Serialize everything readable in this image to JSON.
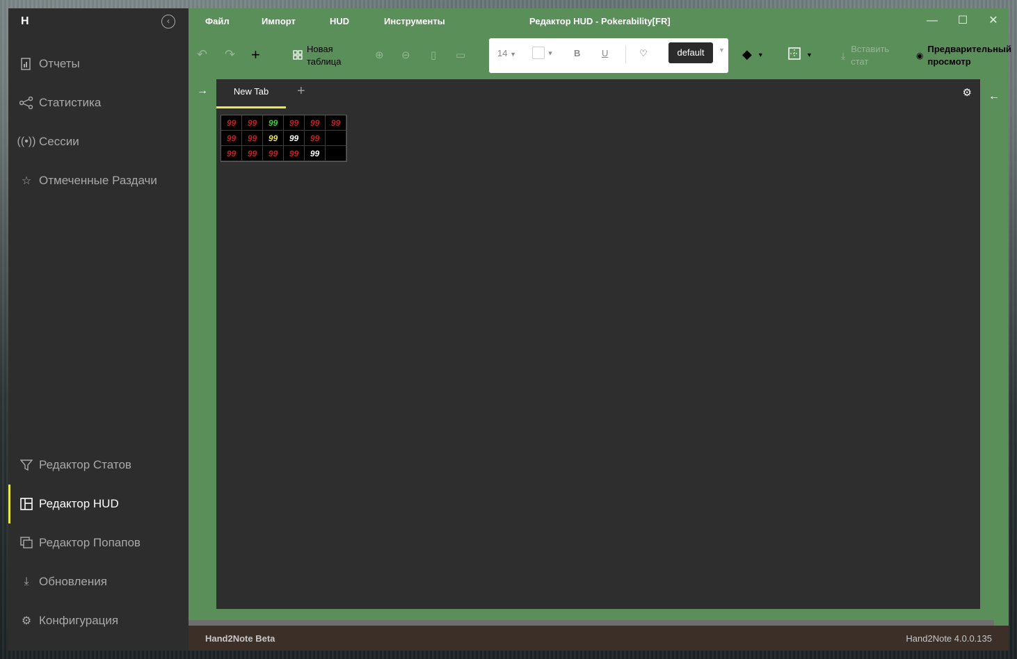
{
  "app": {
    "window_title": "Редактор HUD - Pokerability[FR]",
    "logo": "H"
  },
  "colors": {
    "accent": "#e8e84a",
    "main_bg": "#5a8f5a",
    "sidebar_bg": "#2d2d2d",
    "editor_bg": "#2e2e2e",
    "status_bg": "#3b2f27",
    "stat_red": "#d11d1d",
    "stat_green": "#2fd82f",
    "stat_yellow": "#e8e84a",
    "stat_white": "#ffffff"
  },
  "sidebar": {
    "items_top": [
      {
        "label": "Отчеты",
        "icon": "report-icon"
      },
      {
        "label": "Статистика",
        "icon": "share-graph-icon"
      },
      {
        "label": "Сессии",
        "icon": "broadcast-icon"
      },
      {
        "label": "Отмеченные Раздачи",
        "icon": "star-list-icon"
      }
    ],
    "items_bottom": [
      {
        "label": "Редактор Статов",
        "icon": "filter-icon"
      },
      {
        "label": "Редактор HUD",
        "icon": "layout-icon",
        "active": true
      },
      {
        "label": "Редактор Попапов",
        "icon": "windows-icon"
      },
      {
        "label": "Обновления",
        "icon": "download-icon"
      },
      {
        "label": "Конфигурация",
        "icon": "gear-icon"
      }
    ]
  },
  "menubar": {
    "items": [
      "Файл",
      "Импорт",
      "HUD",
      "Инструменты"
    ]
  },
  "toolbar": {
    "new_table_line1": "Новая",
    "new_table_line2": "таблица",
    "font_size": "14",
    "bold": "B",
    "underline": "U",
    "style_value": "default",
    "insert_stat_line1": "Вставить",
    "insert_stat_line2": "стат",
    "preview_line1": "Предварительный",
    "preview_line2": "просмотр"
  },
  "editor": {
    "tab_label": "New Tab",
    "hud_rows": [
      [
        {
          "v": "99",
          "c": "red"
        },
        {
          "v": "99",
          "c": "red"
        },
        {
          "v": "99",
          "c": "green"
        },
        {
          "v": "99",
          "c": "red"
        },
        {
          "v": "99",
          "c": "red"
        },
        {
          "v": "99",
          "c": "red"
        }
      ],
      [
        {
          "v": "99",
          "c": "red"
        },
        {
          "v": "99",
          "c": "red"
        },
        {
          "v": "99",
          "c": "yellow"
        },
        {
          "v": "99",
          "c": "white"
        },
        {
          "v": "99",
          "c": "red"
        },
        {
          "v": "",
          "c": "red"
        }
      ],
      [
        {
          "v": "99",
          "c": "red"
        },
        {
          "v": "99",
          "c": "red"
        },
        {
          "v": "99",
          "c": "red"
        },
        {
          "v": "99",
          "c": "red"
        },
        {
          "v": "99",
          "c": "white"
        },
        {
          "v": "",
          "c": "red"
        }
      ]
    ]
  },
  "status": {
    "left": "Hand2Note Beta",
    "right": "Hand2Note 4.0.0.135"
  }
}
